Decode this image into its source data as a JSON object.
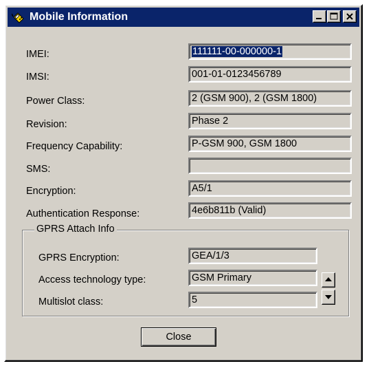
{
  "window": {
    "title": "Mobile Information",
    "icon": "mobile-phone-icon",
    "controls": [
      "minimize-icon",
      "maximize-icon",
      "close-icon"
    ]
  },
  "fields": [
    {
      "label": "IMEI:",
      "value": "111111-00-000000-1",
      "selected": true
    },
    {
      "label": "IMSI:",
      "value": "001-01-0123456789"
    },
    {
      "label": "Power Class:",
      "value": "2 (GSM 900), 2 (GSM 1800)"
    },
    {
      "label": "Revision:",
      "value": "Phase 2"
    },
    {
      "label": "Frequency Capability:",
      "value": "P-GSM 900, GSM 1800"
    },
    {
      "label": "SMS:",
      "value": ""
    },
    {
      "label": "Encryption:",
      "value": "A5/1"
    },
    {
      "label": "Authentication Response:",
      "value": "4e6b811b (Valid)"
    }
  ],
  "gprs": {
    "title": "GPRS Attach Info",
    "fields": [
      {
        "label": "GPRS Encryption:",
        "value": "GEA/1/3"
      },
      {
        "label": "Access technology type:",
        "value": "GSM Primary"
      },
      {
        "label": "Multislot class:",
        "value": "5"
      }
    ]
  },
  "buttons": {
    "close_label": "Close"
  },
  "colors": {
    "titlebar": "#0a246a",
    "face": "#d4d0c8",
    "selection": "#0a246a"
  }
}
